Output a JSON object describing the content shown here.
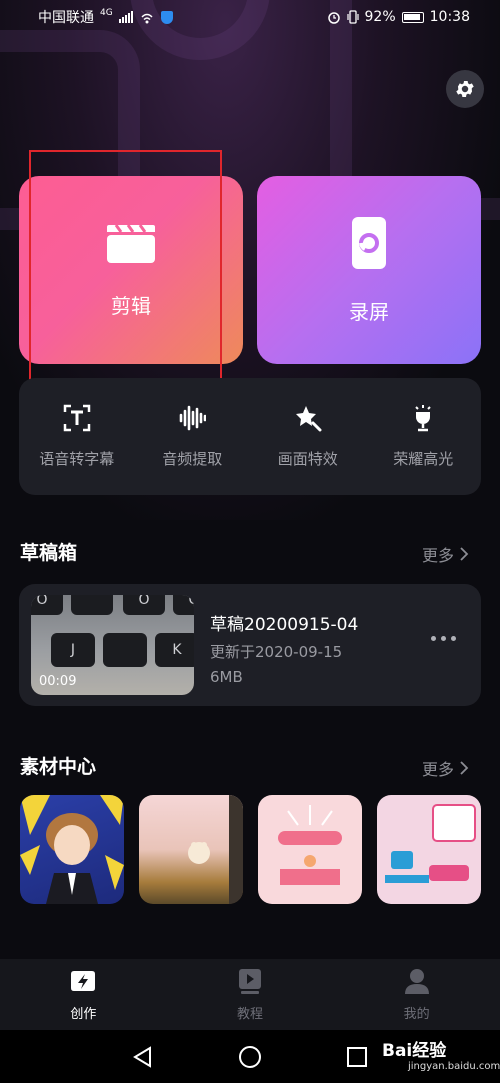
{
  "status_bar": {
    "carrier": "中国联通",
    "network": "4G",
    "battery": "92%",
    "time": "10:38"
  },
  "cards": {
    "edit_label": "剪辑",
    "record_label": "录屏"
  },
  "tools": [
    {
      "label": "语音转字幕",
      "icon": "text-recognition-icon"
    },
    {
      "label": "音频提取",
      "icon": "audio-wave-icon"
    },
    {
      "label": "画面特效",
      "icon": "magic-star-icon"
    },
    {
      "label": "荣耀高光",
      "icon": "trophy-icon"
    }
  ],
  "drafts": {
    "title": "草稿箱",
    "more": "更多",
    "item": {
      "name": "草稿20200915-04",
      "updated": "更新于2020-09-15",
      "size": "6MB",
      "duration": "00:09"
    }
  },
  "materials": {
    "title": "素材中心",
    "more": "更多"
  },
  "tabs": [
    {
      "label": "创作",
      "active": true
    },
    {
      "label": "教程",
      "active": false
    },
    {
      "label": "我的",
      "active": false
    }
  ],
  "watermark": {
    "brand": "Bai经验",
    "domain": "jingyan.baidu.com"
  },
  "colors": {
    "edit_card": "#fd5d93",
    "record_card": "#b66ff0",
    "highlight": "#e0262c",
    "panel": "#1e1f26"
  }
}
